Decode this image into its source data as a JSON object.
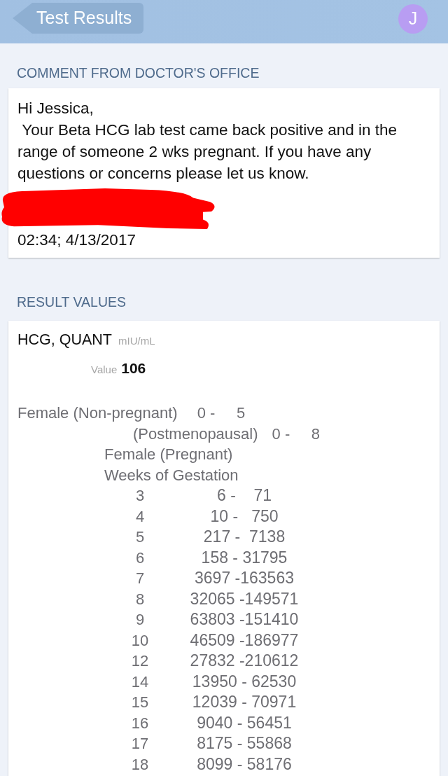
{
  "header": {
    "back_button": {
      "label": "Test Results"
    },
    "avatar": {
      "initial": "J"
    }
  },
  "comment": {
    "title": "COMMENT FROM DOCTOR'S OFFICE",
    "greeting": "Hi Jessica,",
    "message": " Your Beta HCG lab test came back positive and in the range of someone 2 wks pregnant. If you have any questions or concerns please let us know.",
    "signature_redacted": true,
    "timestamp": "02:34; 4/13/2017"
  },
  "results": {
    "title": "RESULT VALUES",
    "test_name": "HCG, QUANT",
    "unit": "mIU/mL",
    "value_label": "Value",
    "value": "106",
    "reference_lines": [
      {
        "kind": "range",
        "label": "Female (Non-pregnant)",
        "range": "0 -     5"
      },
      {
        "kind": "subrange",
        "label": "(Postmenopausal)",
        "range": "0 -     8"
      },
      {
        "kind": "heading",
        "label": "Female (Pregnant)"
      },
      {
        "kind": "heading",
        "label": "Weeks of Gestation"
      }
    ],
    "gestation_rows": [
      {
        "week": "3",
        "range": "6 -    71"
      },
      {
        "week": "4",
        "range": "10 -   750"
      },
      {
        "week": "5",
        "range": "217 -  7138"
      },
      {
        "week": "6",
        "range": "158 - 31795"
      },
      {
        "week": "7",
        "range": "3697 -163563"
      },
      {
        "week": "8",
        "range": "32065 -149571"
      },
      {
        "week": "9",
        "range": "63803 -151410"
      },
      {
        "week": "10",
        "range": "46509 -186977"
      },
      {
        "week": "12",
        "range": "27832 -210612"
      },
      {
        "week": "14",
        "range": "13950 - 62530"
      },
      {
        "week": "15",
        "range": "12039 - 70971"
      },
      {
        "week": "16",
        "range": "9040 - 56451"
      },
      {
        "week": "17",
        "range": "8175 - 55868"
      },
      {
        "week": "18",
        "range": "8099 - 58176"
      }
    ]
  }
}
